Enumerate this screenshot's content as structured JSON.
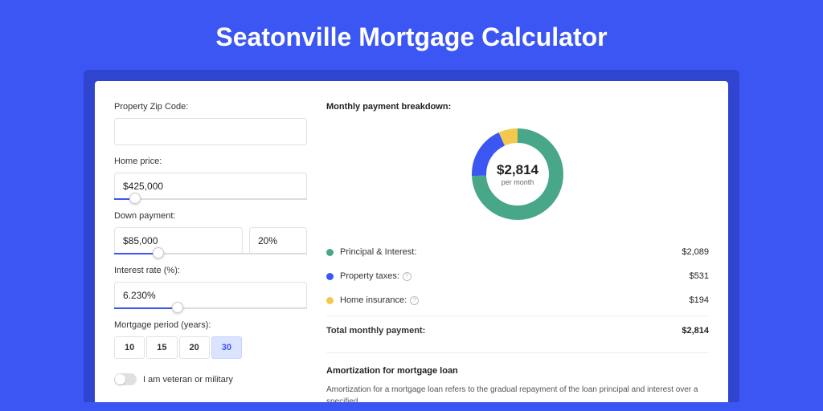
{
  "page_title": "Seatonville Mortgage Calculator",
  "form": {
    "zip_label": "Property Zip Code:",
    "zip_value": "",
    "home_price_label": "Home price:",
    "home_price_value": "$425,000",
    "home_price_slider_pct": 8,
    "down_payment_label": "Down payment:",
    "down_payment_value": "$85,000",
    "down_payment_pct_value": "20%",
    "down_payment_slider_pct": 20,
    "interest_label": "Interest rate (%):",
    "interest_value": "6.230%",
    "interest_slider_pct": 30,
    "period_label": "Mortgage period (years):",
    "periods": [
      {
        "label": "10",
        "active": false
      },
      {
        "label": "15",
        "active": false
      },
      {
        "label": "20",
        "active": false
      },
      {
        "label": "30",
        "active": true
      }
    ],
    "veteran_label": "I am veteran or military",
    "veteran_on": false
  },
  "breakdown": {
    "title": "Monthly payment breakdown:",
    "total_display": "$2,814",
    "total_sub": "per month",
    "items": [
      {
        "label": "Principal & Interest:",
        "value_display": "$2,089",
        "value": 2089,
        "color": "#48a789",
        "info": false
      },
      {
        "label": "Property taxes:",
        "value_display": "$531",
        "value": 531,
        "color": "#3c56f4",
        "info": true
      },
      {
        "label": "Home insurance:",
        "value_display": "$194",
        "value": 194,
        "color": "#f2c94c",
        "info": true
      }
    ],
    "total_row_label": "Total monthly payment:",
    "total_row_value": "$2,814"
  },
  "chart_data": {
    "type": "pie",
    "title": "Monthly payment breakdown",
    "series": [
      {
        "name": "Principal & Interest",
        "value": 2089,
        "color": "#48a789"
      },
      {
        "name": "Property taxes",
        "value": 531,
        "color": "#3c56f4"
      },
      {
        "name": "Home insurance",
        "value": 194,
        "color": "#f2c94c"
      }
    ],
    "center_label": "$2,814",
    "center_sub": "per month"
  },
  "amortization": {
    "title": "Amortization for mortgage loan",
    "text": "Amortization for a mortgage loan refers to the gradual repayment of the loan principal and interest over a specified"
  }
}
